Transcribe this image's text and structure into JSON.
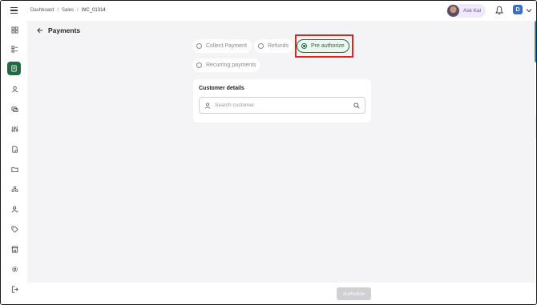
{
  "header": {
    "breadcrumb": [
      "Dashboard",
      "Sales",
      "WC_01314"
    ],
    "ask_kai_label": "Ask Kai",
    "user_initial": "D"
  },
  "sidebar": {
    "items": [
      {
        "icon": "dashboard-icon"
      },
      {
        "icon": "list-icon"
      },
      {
        "icon": "sales-icon",
        "active": true
      },
      {
        "icon": "user-icon"
      },
      {
        "icon": "chat-icon"
      },
      {
        "icon": "sliders-icon"
      },
      {
        "icon": "document-icon"
      },
      {
        "icon": "folder-icon"
      },
      {
        "icon": "group-icon"
      },
      {
        "icon": "user-settings-icon"
      },
      {
        "icon": "tag-icon"
      },
      {
        "icon": "store-icon"
      },
      {
        "icon": "gear-icon"
      },
      {
        "icon": "logout-icon"
      }
    ]
  },
  "page": {
    "title": "Payments",
    "payment_options": [
      {
        "label": "Collect Payment",
        "selected": false
      },
      {
        "label": "Refunds",
        "selected": false
      },
      {
        "label": "Pre authorize",
        "selected": true
      },
      {
        "label": "Recurring payments",
        "selected": false
      }
    ],
    "customer_details": {
      "title": "Customer details",
      "search_placeholder": "Search customer"
    },
    "authorize_button": "Authorize"
  },
  "colors": {
    "accent": "#1f6b43",
    "highlight": "#e0251b",
    "ask_kai_bg": "#efe9f8",
    "avatar_bg": "#3a6fc4"
  }
}
